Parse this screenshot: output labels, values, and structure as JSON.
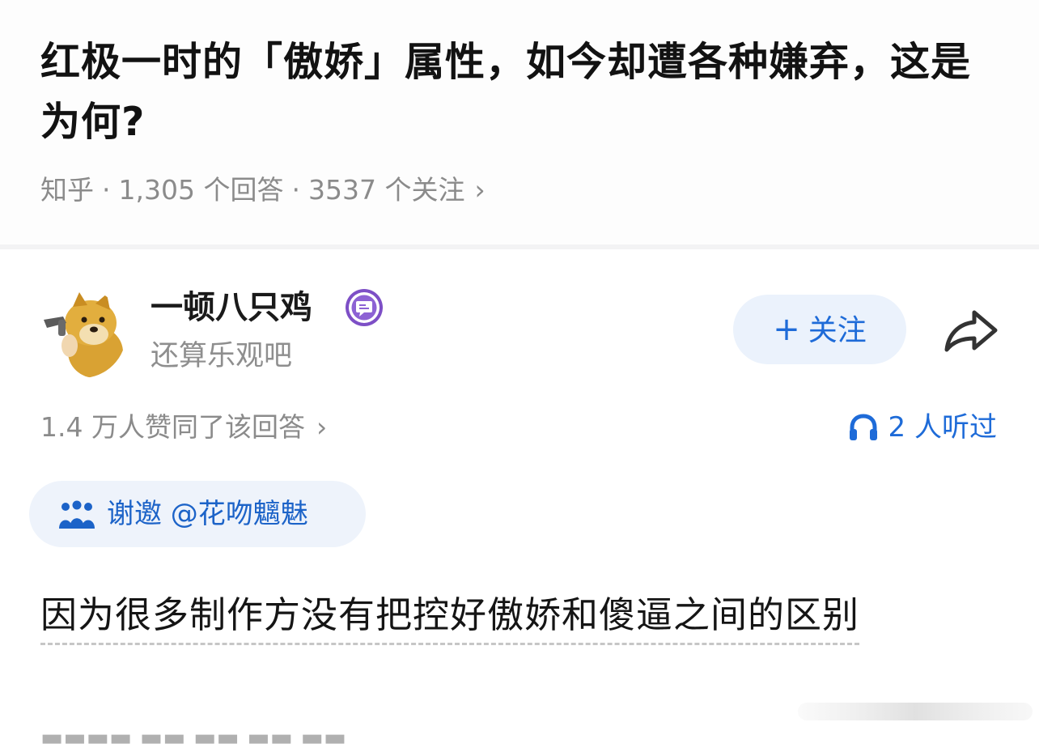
{
  "question": {
    "title": "红极一时的「傲娇」属性，如今却遭各种嫌弃，这是为何?",
    "source": "知乎",
    "answers": "1,305 个回答",
    "followers": "3537 个关注",
    "separator": "·",
    "chevron": "›"
  },
  "author": {
    "name": "一顿八只鸡",
    "bio": "还算乐观吧",
    "badge_icon": "chat-badge-icon",
    "avatar_icon": "doge-avatar"
  },
  "actions": {
    "follow_plus": "+",
    "follow_label": "关注",
    "share_icon": "share-arrow-icon"
  },
  "answer": {
    "votes": "1.4 万人赞同了该回答",
    "votes_chevron": "›",
    "listen_count": "2 人听过",
    "invite": "谢邀 @花吻魑魅",
    "content": "因为很多制作方没有把控好傲娇和傻逼之间的区别"
  },
  "colors": {
    "accent": "#1e6bd8",
    "follow_bg": "#ebf2fc",
    "badge_purple": "#7d4fc6",
    "muted_text": "#8b8b8b"
  }
}
